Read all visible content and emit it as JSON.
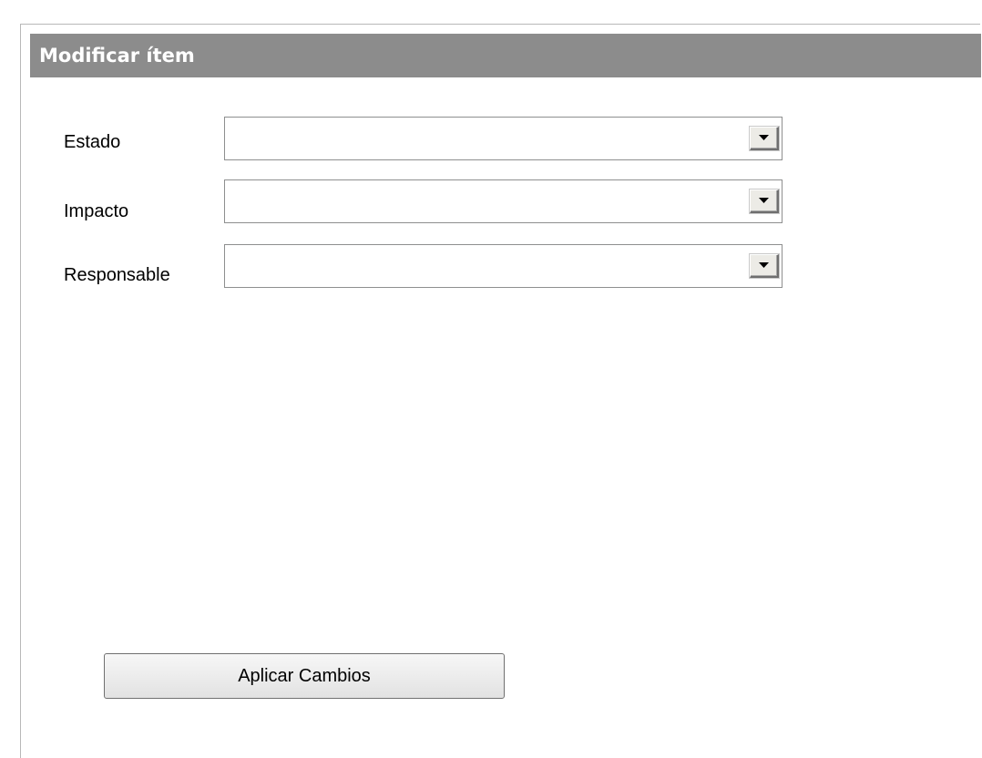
{
  "panel": {
    "title": "Modificar ítem"
  },
  "form": {
    "fields": [
      {
        "label": "Estado",
        "value": ""
      },
      {
        "label": "Impacto",
        "value": ""
      },
      {
        "label": "Responsable",
        "value": ""
      }
    ],
    "apply_label": "Aplicar Cambios"
  },
  "colors": {
    "title_bar": "#8c8c8c",
    "title_text": "#ffffff"
  },
  "icons": {
    "dropdown": "triangle-down-icon"
  }
}
